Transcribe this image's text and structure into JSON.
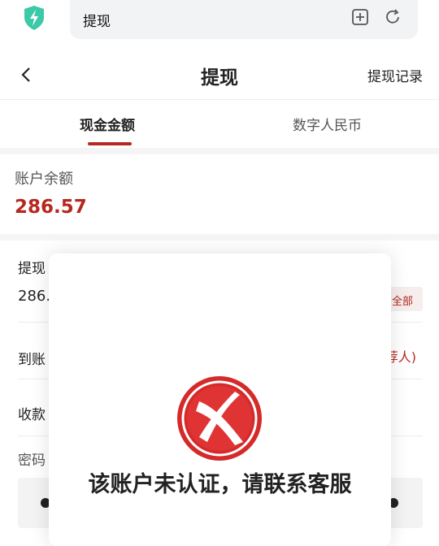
{
  "browser": {
    "url_text": "提现",
    "icons": {
      "shield": "shield-lightning-icon",
      "add": "add-bookmark-icon",
      "reload": "reload-icon"
    }
  },
  "header": {
    "title": "提现",
    "record_link": "提现记录",
    "back_icon": "chevron-left-icon"
  },
  "tabs": [
    {
      "label": "现金金额",
      "active": true
    },
    {
      "label": "数字人民币",
      "active": false
    }
  ],
  "balance": {
    "label": "账户余额",
    "amount": "286.57"
  },
  "form": {
    "amount_label": "提现",
    "amount_value": "286.",
    "all_button": "全部",
    "arrival_label": "到账",
    "arrival_suffix": "荐人)",
    "payee_label": "收款",
    "password_label": "密码"
  },
  "modal": {
    "message": "该账户未认证，请联系客服",
    "icon": "error-x-icon"
  },
  "colors": {
    "accent": "#b5281f",
    "shield": "#3cc9a8"
  }
}
